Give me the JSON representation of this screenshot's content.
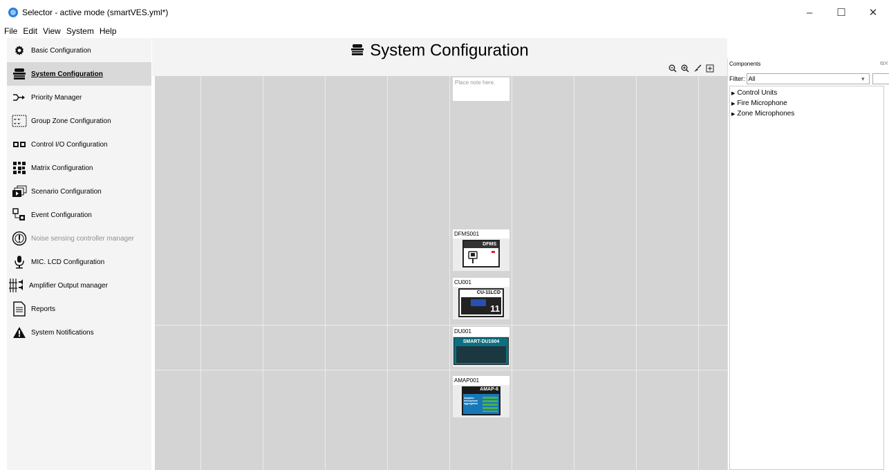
{
  "window": {
    "title": "Selector - active mode (smartVES.yml*)",
    "minimize": "–",
    "maximize": "☐",
    "close": "✕"
  },
  "menu": [
    "File",
    "Edit",
    "View",
    "System",
    "Help"
  ],
  "sidebar": {
    "items": [
      {
        "label": "Basic Configuration",
        "icon": "gear-icon"
      },
      {
        "label": "System Configuration",
        "icon": "system-config-icon"
      },
      {
        "label": "Priority Manager",
        "icon": "priority-arrow-icon"
      },
      {
        "label": "Group Zone Configuration",
        "icon": "group-zone-icon"
      },
      {
        "label": "Control I/O Configuration",
        "icon": "control-io-icon"
      },
      {
        "label": "Matrix Configuration",
        "icon": "matrix-icon"
      },
      {
        "label": "Scenario Configuration",
        "icon": "scenario-icon"
      },
      {
        "label": "Event Configuration",
        "icon": "event-icon"
      },
      {
        "label": "Noise sensing controller manager",
        "icon": "noise-sensor-icon"
      },
      {
        "label": "MIC. LCD Configuration",
        "icon": "microphone-icon"
      },
      {
        "label": "Amplifier Output manager",
        "icon": "amplifier-icon"
      },
      {
        "label": "Reports",
        "icon": "report-document-icon"
      },
      {
        "label": "System Notifications",
        "icon": "warning-icon"
      }
    ]
  },
  "main": {
    "title": "System Configuration",
    "note_placeholder": "Place note here.",
    "devices": [
      {
        "id": "DFMS001",
        "model": "DFMS"
      },
      {
        "id": "CU001",
        "model": "CU-11LCD",
        "number": "11"
      },
      {
        "id": "DU001",
        "model": "SMART-DU1604"
      },
      {
        "id": "AMAP001",
        "model": "AMAP-6",
        "desc": "Adaptive microphone aggregation"
      }
    ]
  },
  "components": {
    "title": "Components",
    "filter_label": "Filter:",
    "filter_value": "All",
    "tree": [
      "Control Units",
      "Fire Microphone",
      "Zone Microphones"
    ]
  }
}
